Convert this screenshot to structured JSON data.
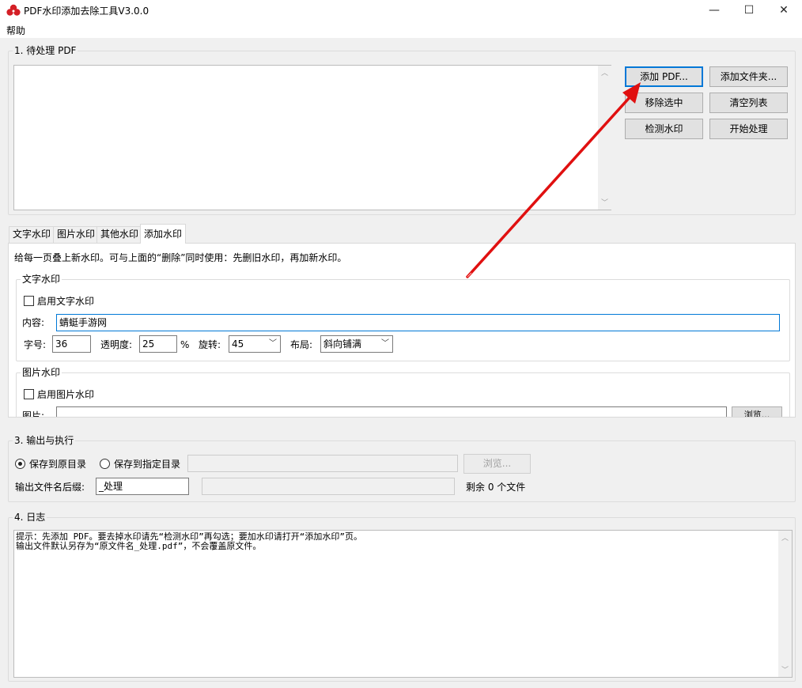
{
  "window": {
    "title": "PDF水印添加去除工具V3.0.0",
    "minimize_glyph": "—",
    "maximize_glyph": "☐",
    "close_glyph": "✕",
    "icon": "red-clover-app-icon"
  },
  "menu": {
    "help": "帮助"
  },
  "section1": {
    "title": "1. 待处理 PDF",
    "buttons": {
      "add_pdf": "添加 PDF...",
      "add_folder": "添加文件夹...",
      "remove_selected": "移除选中",
      "clear_list": "清空列表",
      "detect_watermark": "检测水印",
      "start_process": "开始处理"
    }
  },
  "tabs": {
    "items": [
      "文字水印",
      "图片水印",
      "其他水印",
      "添加水印"
    ],
    "active_index": 3
  },
  "add_watermark": {
    "hint": "给每一页叠上新水印。可与上面的“删除”同时使用：先删旧水印，再加新水印。",
    "text_group": {
      "title": "文字水印",
      "enable_label": "启用文字水印",
      "enabled": false,
      "content_label": "内容:",
      "content_value": "蜻蜓手游网",
      "size_label": "字号:",
      "size_value": "36",
      "opacity_label": "透明度:",
      "opacity_value": "25",
      "opacity_unit": "%",
      "rotation_label": "旋转:",
      "rotation_value": "45",
      "layout_label": "布局:",
      "layout_value": "斜向铺满"
    },
    "image_group": {
      "title": "图片水印",
      "enable_label": "启用图片水印",
      "enabled": false,
      "image_label": "图片:",
      "browse_label": "浏览..."
    }
  },
  "section3": {
    "title": "3. 输出与执行",
    "save_original": "保存到原目录",
    "save_specified": "保存到指定目录",
    "selected": "original",
    "browse": "浏览...",
    "suffix_label": "输出文件名后缀:",
    "suffix_value": "_处理",
    "remaining": "剩余 0 个文件"
  },
  "section4": {
    "title": "4. 日志",
    "lines": [
      "提示：先添加 PDF。要去掉水印请先“检测水印”再勾选；要加水印请打开“添加水印”页。",
      "输出文件默认另存为“原文件名_处理.pdf”，不会覆盖原文件。"
    ]
  },
  "colors": {
    "window_bg": "#f0f0f0",
    "accent": "#0078d7",
    "annotation_arrow": "#e01010"
  }
}
